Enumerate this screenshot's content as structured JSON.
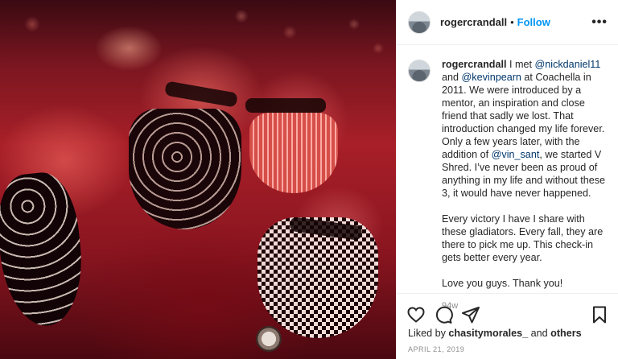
{
  "post": {
    "username": "rogercrandall",
    "separator": "•",
    "follow_label": "Follow",
    "more_icon": "more-icon",
    "more_label": "•••"
  },
  "caption": {
    "username": "rogercrandall",
    "p1_a": " I met ",
    "mention_1": "@nickdaniel11",
    "p1_b": " and ",
    "mention_2": "@kevinpearn",
    "p1_c": " at Coachella in 2011. We were introduced by a mentor, an inspiration and close friend that sadly we lost. That introduction changed my life forever.",
    "p2_a": "Only a few years later, with the addition of ",
    "mention_3": "@vin_sant",
    "p2_b": ", we started V Shred. I’ve never been as proud of anything in my life and without these 3, it would have never happened.",
    "p3": "Every victory I have I share with these gladiators. Every fall, they are there to pick me up. This check-in gets better every year.",
    "p4": "Love you guys. Thank you!",
    "time_ago": "94w"
  },
  "actions": {
    "icons": [
      "heart-icon",
      "comment-icon",
      "share-icon",
      "bookmark-icon"
    ],
    "liked_by_prefix": "Liked by ",
    "liked_by_user": "chasitymorales_",
    "liked_by_mid": " and ",
    "liked_by_others": "others",
    "date": "APRIL 21, 2019"
  },
  "colors": {
    "link": "#0095f6",
    "mention": "#00376b",
    "muted": "#8e8e8e",
    "text": "#262626"
  }
}
